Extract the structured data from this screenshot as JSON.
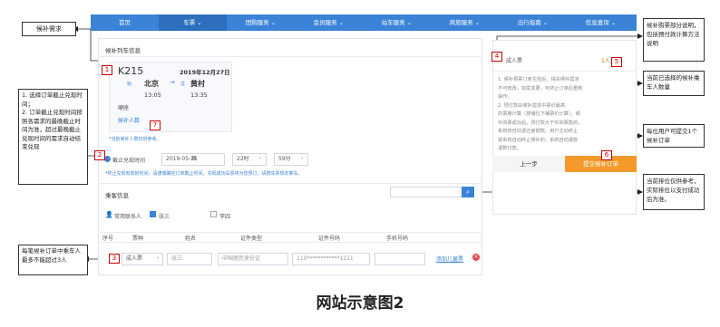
{
  "nav": {
    "items": [
      "首页",
      "车票 ⌄",
      "团购服务 ⌄",
      "会员服务 ⌄",
      "站车服务 ⌄",
      "商旅服务 ⌄",
      "出行指南 ⌄",
      "信息查询 ⌄"
    ]
  },
  "candidate": {
    "section_title": "候补列车信息",
    "train_no": "K215",
    "date": "2019年12月27日",
    "from": "北京",
    "to": "黄村",
    "dep_time": "13:05",
    "arr_time": "13:35",
    "seat": "硬座",
    "seat_label": "候补人数",
    "link_text": "*当前候补人数仅供参考。"
  },
  "deadline": {
    "label": "截止兑现时间",
    "date": "2019-05-21",
    "hour": "22时",
    "minute": "59分",
    "note": "*终止兑现有效的时间，请谨慎确定订单截止时间，兑现成功车票将为您预订，请按车票规定乘车。"
  },
  "passenger": {
    "section_title": "乘客信息",
    "search_placeholder": "",
    "contacts_label": "常用联系人",
    "contact1": "张三",
    "contact2": "李四",
    "table_headers": [
      "序号",
      "票种",
      "姓名",
      "证件类型",
      "证件号码",
      "手机号码"
    ],
    "row": {
      "index": "3",
      "ticket_type": "成人票",
      "name": "张三",
      "id_type": "中国居民身份证",
      "id_no": "110************1211",
      "phone": "",
      "add_child": "添加儿童票"
    }
  },
  "right_panel": {
    "ticket_label": "成人票",
    "count": "1人",
    "lines": [
      "1. 候补预票订单生效后，相关候补需求",
      "不可修改，如需变更，可终止订单后重新",
      "操作。",
      "2. 预付款由候补需求中票价最高",
      "的票席计算（按铺位下铺票价计算）；候",
      "补购票成功后，预付款大于实际票款的，",
      "系统将自动退还差额款。用户主动终止",
      "或系统自动终止候补的，系统自动退款",
      "退款付款。"
    ],
    "prev_button": "上一步",
    "submit_button": "提交候补订单"
  },
  "annotations": {
    "a1": "候补需求",
    "a2": "1. 选择订单截止兑现时间；\n2. 订单截止兑现时间按照各需求的最晚截止时间为准，超过最晚截止兑现时间的需求自动结束兑现",
    "a3": "每笔候补订单中乘车人最多不能超过3人",
    "a4": "候补购票部分说明，包括预付款计算方法说明",
    "a5": "当前已选择的候补乘车人数量",
    "a6": "每位用户可提交1个候补订单",
    "a7": "当前排位仅供参考，实际排位以支付成功后为准。"
  },
  "markers": [
    "1",
    "2",
    "3",
    "4",
    "5",
    "6",
    "7"
  ],
  "caption": "网站示意图2"
}
